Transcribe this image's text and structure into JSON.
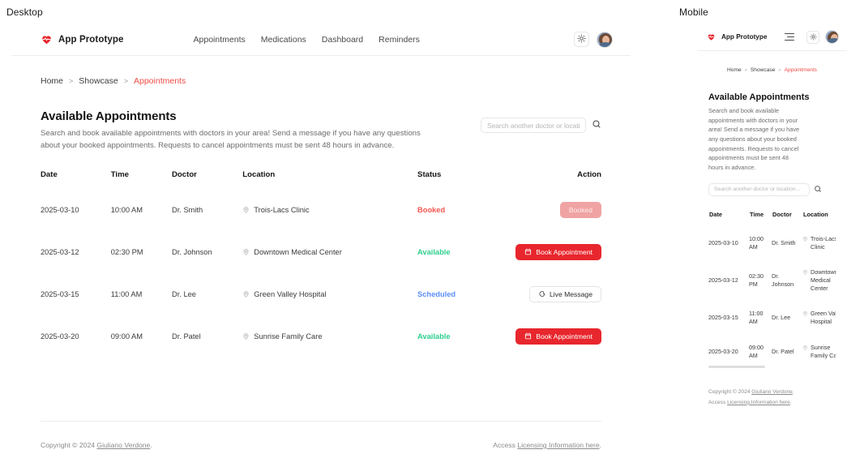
{
  "panels": {
    "desktop_caption": "Desktop",
    "mobile_caption": "Mobile"
  },
  "brand": {
    "name": "App Prototype",
    "logo_icon": "heart-pulse-icon"
  },
  "nav": {
    "items": [
      {
        "label": "Appointments"
      },
      {
        "label": "Medications"
      },
      {
        "label": "Dashboard"
      },
      {
        "label": "Reminders"
      }
    ],
    "theme_toggle_icon": "sun-icon",
    "avatar_icon": "user-avatar",
    "menu_icon": "hamburger-menu-icon"
  },
  "breadcrumb": {
    "items": [
      {
        "label": "Home",
        "active": false
      },
      {
        "label": "Showcase",
        "active": false
      },
      {
        "label": "Appointments",
        "active": true
      }
    ],
    "separator": ">"
  },
  "page": {
    "title": "Available Appointments",
    "description": "Search and book available appointments with doctors in your area! Send a message if you have any questions about your booked appointments. Requests to cancel appointments must be sent 48 hours in advance."
  },
  "search": {
    "placeholder": "Search another doctor or location...",
    "value": "",
    "icon": "search-icon"
  },
  "table": {
    "headers": {
      "date": "Date",
      "time": "Time",
      "doctor": "Doctor",
      "location": "Location",
      "status": "Status",
      "action": "Action"
    },
    "rows": [
      {
        "date": "2025-03-10",
        "time": "10:00 AM",
        "doctor": "Dr. Smith",
        "location": "Trois-Lacs Clinic",
        "status": "Booked",
        "status_kind": "booked",
        "action_label": "Booked",
        "action_kind": "disabled",
        "action_icon": "none"
      },
      {
        "date": "2025-03-12",
        "time": "02:30 PM",
        "doctor": "Dr. Johnson",
        "location": "Downtown Medical Center",
        "status": "Available",
        "status_kind": "available",
        "action_label": "Book Appointment",
        "action_kind": "primary",
        "action_icon": "calendar-icon"
      },
      {
        "date": "2025-03-15",
        "time": "11:00 AM",
        "doctor": "Dr. Lee",
        "location": "Green Valley Hospital",
        "status": "Scheduled",
        "status_kind": "scheduled",
        "action_label": "Live Message",
        "action_kind": "outline",
        "action_icon": "chat-bubble-icon"
      },
      {
        "date": "2025-03-20",
        "time": "09:00 AM",
        "doctor": "Dr. Patel",
        "location": "Sunrise Family Care",
        "status": "Available",
        "status_kind": "available",
        "action_label": "Book Appointment",
        "action_kind": "primary",
        "action_icon": "calendar-icon"
      }
    ]
  },
  "footer": {
    "copyright_prefix": "Copyright © 2024 ",
    "copyright_link": "Giuliano Verdone",
    "copyright_suffix": ".",
    "license_prefix": "Access ",
    "license_link": "Licensing Information here",
    "license_suffix": "."
  },
  "colors": {
    "brand_red": "#e8262d",
    "accent_link": "#ef4b46",
    "status_booked": "#f2564f",
    "status_available": "#2ecf8d",
    "status_scheduled": "#5b8ef7",
    "disabled_button": "#f0a3a3",
    "border": "#ededed",
    "muted_text": "#6d6d6d"
  }
}
